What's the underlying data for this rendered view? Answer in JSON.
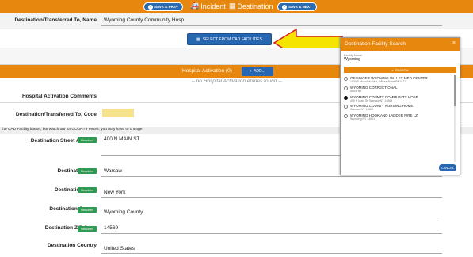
{
  "topbar": {
    "save_prev": "SAVE & PREV",
    "incident": "Incident",
    "destination": "Destination",
    "save_next": "SAVE & NEXT"
  },
  "form": {
    "dest_name_label": "Destination/Transferred To, Name",
    "dest_name_value": "Wyoming County Community Hosp",
    "select_cad": "SELECT FROM CAD FACILITIES",
    "hospital_activation": "Hospital Activation (0)",
    "add": "ADD...",
    "no_entries": "-- no Hospital Activation entries found --",
    "hosp_comments": "Hospital Activation Comments",
    "dest_code_label": "Destination/Transferred To, Code",
    "hint": "the CAD Facility button, but watch out for COUNTY errors, you may have to change",
    "required": "Required",
    "street_label": "Destination Street Address",
    "street_value": "400 N MAIN ST",
    "city_label": "Destination City",
    "city_value": "Warsaw",
    "state_label": "Destination State",
    "state_value": "New York",
    "county_label": "Destination County",
    "county_value": "Wyoming County",
    "zip_label": "Destination ZIP Code",
    "zip_value": "14569",
    "country_label": "Destination Country",
    "country_value": "United States"
  },
  "modal": {
    "title": "Destination Facility Search",
    "close": "×",
    "field_label": "Facility Name",
    "field_value": "Wyoming",
    "search": "SEARCH",
    "cancel": "CANCEL",
    "items": [
      {
        "name": "GEISINGER WYOMING VALLEY MED CENTER",
        "sub": "1000 E Mountain Blvd, Wilkes-Barre PA 18711"
      },
      {
        "name": "WYOMING CORRECTIONAL",
        "sub": "Attica NY"
      },
      {
        "name": "WYOMING COUNTY COMMUNITY HOSP",
        "sub": "400 N Main St, Warsaw NY 14569"
      },
      {
        "name": "WYOMING COUNTY NURSING HOME",
        "sub": "Warsaw NY 14569"
      },
      {
        "name": "WYOMING HOOK AND LADDER FIRE LZ",
        "sub": "Wyoming NY 14591"
      }
    ]
  },
  "colors": {
    "accent": "#e8870e",
    "primary": "#2766b0",
    "required": "#2e9a52",
    "arrow": "#f5e400"
  }
}
